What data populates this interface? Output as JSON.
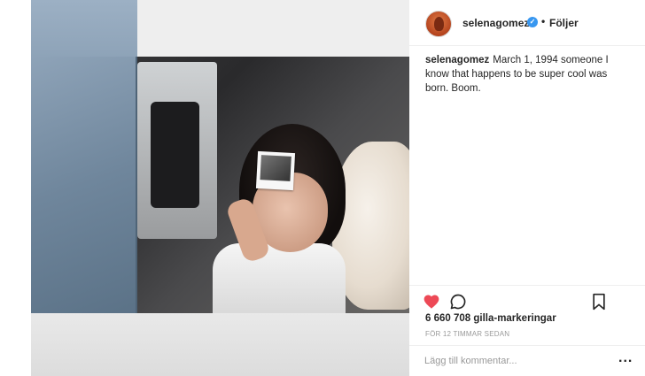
{
  "post": {
    "username": "selenagomez",
    "follow_label": "Följer",
    "dot": "•",
    "caption_user": "selenagomez",
    "caption_text": "March 1, 1994 someone I know that happens to be super cool was born. Boom.",
    "likes_text": "6 660 708 gilla-markeringar",
    "timestamp": "FÖR 12 TIMMAR SEDAN",
    "comment_placeholder": "Lägg till kommentar...",
    "more_label": "..."
  },
  "icons": {
    "like": "heart-icon",
    "comment": "speech-bubble-icon",
    "save": "bookmark-icon",
    "verified": "verified-badge-icon",
    "more": "more-options-icon"
  },
  "colors": {
    "like_red": "#ed4956",
    "verified_blue": "#3897f0",
    "muted_text": "#999999"
  }
}
